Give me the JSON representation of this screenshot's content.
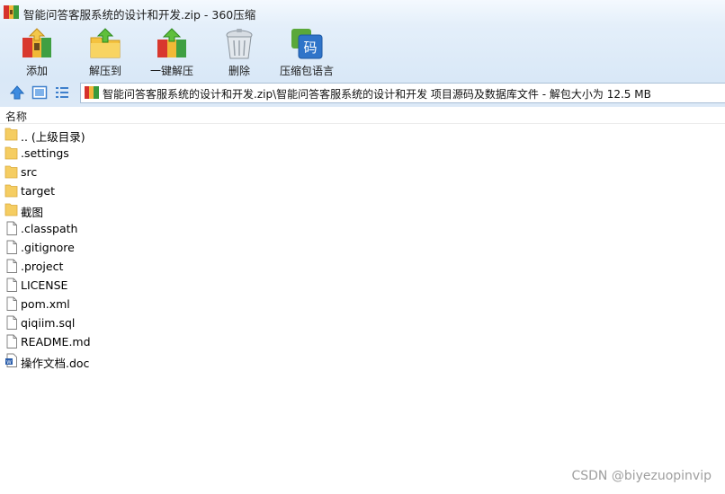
{
  "window": {
    "title": "智能问答客服系统的设计和开发.zip - 360压缩"
  },
  "toolbar": {
    "buttons": [
      {
        "label": "添加",
        "icon": "add-archive-icon"
      },
      {
        "label": "解压到",
        "icon": "extract-to-icon"
      },
      {
        "label": "一键解压",
        "icon": "one-click-extract-icon"
      },
      {
        "label": "删除",
        "icon": "trash-can-icon"
      },
      {
        "label": "压缩包语言",
        "icon": "archive-language-icon"
      }
    ]
  },
  "nav": {
    "icons": [
      "up-arrow-icon",
      "view-thumbnail-icon",
      "view-list-icon"
    ]
  },
  "address": {
    "path": "智能问答客服系统的设计和开发.zip\\智能问答客服系统的设计和开发 项目源码及数据库文件 - 解包大小为 12.5 MB"
  },
  "list": {
    "column_name": "名称",
    "items": [
      {
        "name": ".. (上级目录)",
        "type": "folder"
      },
      {
        "name": ".settings",
        "type": "folder"
      },
      {
        "name": "src",
        "type": "folder"
      },
      {
        "name": "target",
        "type": "folder"
      },
      {
        "name": "截图",
        "type": "folder"
      },
      {
        "name": ".classpath",
        "type": "file"
      },
      {
        "name": ".gitignore",
        "type": "file"
      },
      {
        "name": ".project",
        "type": "file"
      },
      {
        "name": "LICENSE",
        "type": "file"
      },
      {
        "name": "pom.xml",
        "type": "file"
      },
      {
        "name": "qiqiim.sql",
        "type": "file"
      },
      {
        "name": "README.md",
        "type": "file"
      },
      {
        "name": "操作文档.doc",
        "type": "doc"
      }
    ]
  },
  "watermark": "CSDN @biyezuopinvip",
  "colors": {
    "folder": "#f5cd62",
    "chrome_blue": "#dce9f7",
    "doc_blue": "#2b5eab"
  }
}
